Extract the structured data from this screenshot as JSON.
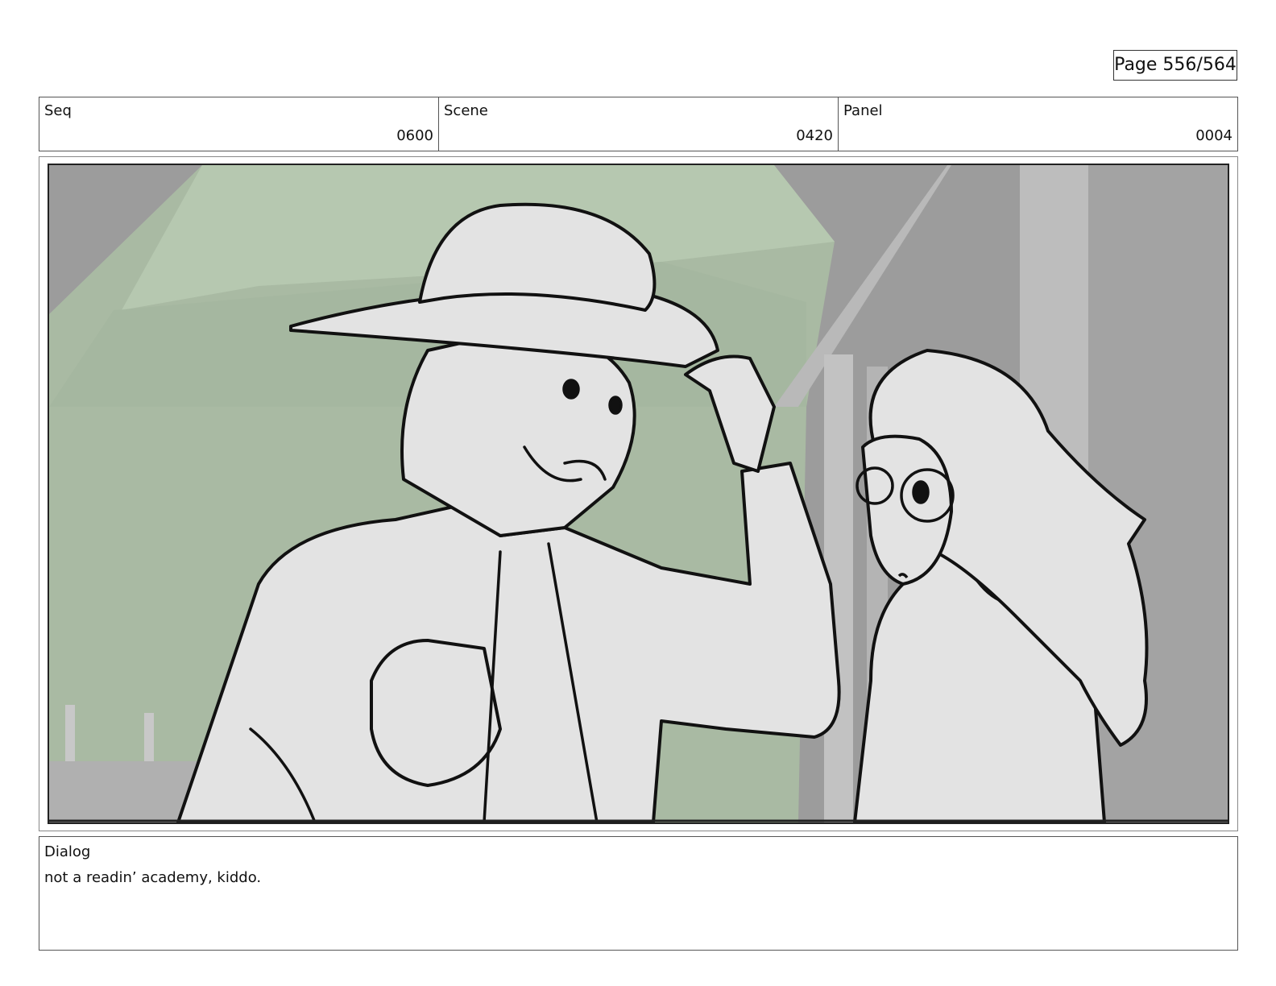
{
  "page": {
    "label": "Page 556/564"
  },
  "header": {
    "seq": {
      "label": "Seq",
      "value": "0600"
    },
    "scene": {
      "label": "Scene",
      "value": "0420"
    },
    "panel": {
      "label": "Panel",
      "value": "0004"
    }
  },
  "artwork": {
    "description_icon": "storyboard-sketch-image",
    "colors": {
      "background_gray": "#9a9a9a",
      "awning_green": "#aebfa7",
      "figure_fill": "#e3e3e3",
      "line": "#111111"
    }
  },
  "dialog": {
    "label": "Dialog",
    "text": "not a readin’ academy, kiddo."
  }
}
